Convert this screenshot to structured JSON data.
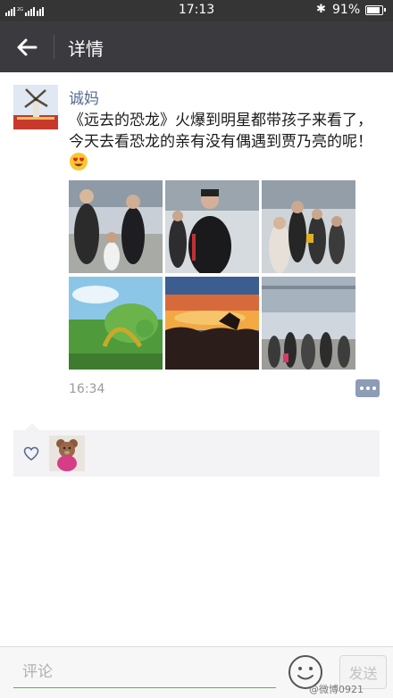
{
  "status_bar": {
    "network_label": "2G 4G 4G",
    "time": "17:13",
    "battery_text": "91%",
    "battery_level": 0.91
  },
  "nav": {
    "title": "详情"
  },
  "post": {
    "author": "诚妈",
    "text": "《远去的恐龙》火爆到明星都带孩子来看了，今天去看恐龙的亲有没有偶遇到贾乃亮的呢！",
    "emoji": "heart-eyes-emoji",
    "photo_count": 6,
    "time": "16:34"
  },
  "likes": {
    "icon": "heart-outline-icon",
    "count": 1
  },
  "comment_bar": {
    "placeholder": "评论",
    "send_label": "发送"
  },
  "watermark": "@微博0921",
  "colors": {
    "nav_bg": "#3b3b3f",
    "link_blue": "#576b95",
    "accent_green": "#4cb845",
    "likes_bg": "#f3f3f5"
  }
}
